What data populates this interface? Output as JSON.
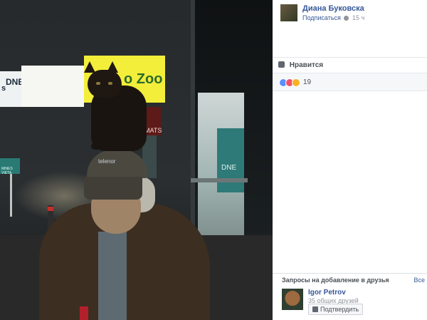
{
  "photo": {
    "sign_dnb_left": "DNB",
    "sign_dnb_prefix": "s",
    "sign_zoo": "o Zoo",
    "atm_sign": "OMATS",
    "parking_sign": "MINES VIETA",
    "door_sign": "DNE",
    "cap_brand": "telenor"
  },
  "post": {
    "author_name": "Диана Буковска",
    "subscribe_label": "Подписаться",
    "time": "15 ч",
    "like_label": "Нравится",
    "reaction_count": "19"
  },
  "friend_requests": {
    "title": "Запросы на добавление в друзья",
    "see_all": "Все",
    "request": {
      "name": "Igor Petrov",
      "mutual": "35 общих друзей",
      "confirm_label": "Подтвердить"
    }
  },
  "colors": {
    "link": "#365899",
    "muted": "#90949c",
    "like_reaction": "#5890ff",
    "love_reaction": "#f25268",
    "wow_reaction": "#f7b125"
  },
  "icons": {
    "like": "thumbs-up-icon",
    "globe": "globe-icon",
    "add_friend": "add-friend-icon"
  }
}
